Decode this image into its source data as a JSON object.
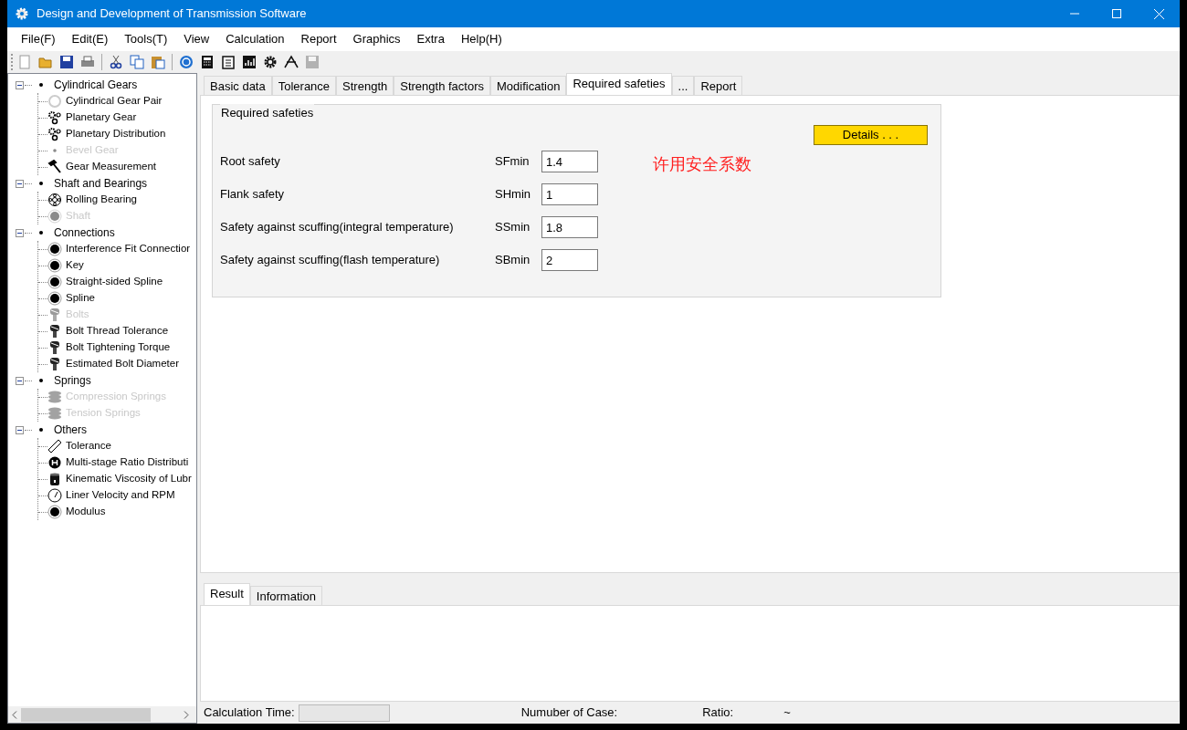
{
  "window": {
    "title": "Design and Development of Transmission Software"
  },
  "menu": [
    "File(F)",
    "Edit(E)",
    "Tools(T)",
    "View",
    "Calculation",
    "Report",
    "Graphics",
    "Extra",
    "Help(H)"
  ],
  "toolbar": [
    {
      "kind": "new",
      "disabled": false
    },
    {
      "kind": "open",
      "disabled": false
    },
    {
      "kind": "save",
      "disabled": false
    },
    {
      "kind": "print",
      "disabled": false
    },
    {
      "kind": "separator"
    },
    {
      "kind": "cut",
      "disabled": false
    },
    {
      "kind": "copy",
      "disabled": false
    },
    {
      "kind": "paste",
      "disabled": false
    },
    {
      "kind": "separator"
    },
    {
      "kind": "help",
      "disabled": false
    },
    {
      "kind": "calculator",
      "disabled": false
    },
    {
      "kind": "clipboard",
      "disabled": false
    },
    {
      "kind": "chart",
      "disabled": false
    },
    {
      "kind": "gear",
      "disabled": false
    },
    {
      "kind": "compass",
      "disabled": false
    },
    {
      "kind": "save",
      "disabled": true
    }
  ],
  "tree": [
    {
      "label": "Cylindrical Gears",
      "expanded": true,
      "children": [
        {
          "label": "Cylindrical Gear Pair",
          "kind": "ring",
          "disabled": false
        },
        {
          "label": "Planetary Gear",
          "kind": "gears",
          "disabled": false
        },
        {
          "label": "Planetary Distribution",
          "kind": "gears",
          "disabled": false
        },
        {
          "label": "Bevel Gear",
          "kind": "dot",
          "disabled": true
        },
        {
          "label": "Gear Measurement",
          "kind": "hammer",
          "disabled": false
        }
      ]
    },
    {
      "label": "Shaft and Bearings",
      "expanded": true,
      "children": [
        {
          "label": "Rolling Bearing",
          "kind": "bearing",
          "disabled": false
        },
        {
          "label": "Shaft",
          "kind": "target",
          "disabled": true
        }
      ]
    },
    {
      "label": "Connections",
      "expanded": true,
      "children": [
        {
          "label": "Interference Fit Connectior",
          "kind": "target",
          "disabled": false
        },
        {
          "label": "Key",
          "kind": "target",
          "disabled": false
        },
        {
          "label": "Straight-sided Spline",
          "kind": "target",
          "disabled": false
        },
        {
          "label": "Spline",
          "kind": "target",
          "disabled": false
        },
        {
          "label": "Bolts",
          "kind": "bolt",
          "disabled": true
        },
        {
          "label": "Bolt Thread Tolerance",
          "kind": "bolt",
          "disabled": false
        },
        {
          "label": "Bolt Tightening Torque",
          "kind": "bolt",
          "disabled": false
        },
        {
          "label": "Estimated Bolt Diameter",
          "kind": "bolt",
          "disabled": false
        }
      ]
    },
    {
      "label": "Springs",
      "expanded": true,
      "children": [
        {
          "label": "Compression Springs",
          "kind": "spring",
          "disabled": true
        },
        {
          "label": "Tension Springs",
          "kind": "spring",
          "disabled": true
        }
      ]
    },
    {
      "label": "Others",
      "expanded": true,
      "children": [
        {
          "label": "Tolerance",
          "kind": "ruler",
          "disabled": false
        },
        {
          "label": "Multi-stage Ratio Distributi",
          "kind": "ratio",
          "disabled": false
        },
        {
          "label": "Kinematic Viscosity of Lubr",
          "kind": "cup",
          "disabled": false
        },
        {
          "label": "Liner Velocity and RPM",
          "kind": "gauge",
          "disabled": false
        },
        {
          "label": "Modulus",
          "kind": "target",
          "disabled": false
        }
      ]
    }
  ],
  "tabs": [
    {
      "label": "Basic data",
      "selected": false
    },
    {
      "label": "Tolerance",
      "selected": false
    },
    {
      "label": "Strength",
      "selected": false
    },
    {
      "label": "Strength factors",
      "selected": false
    },
    {
      "label": "Modification",
      "selected": false
    },
    {
      "label": "Required safeties",
      "selected": true
    },
    {
      "label": "...",
      "selected": false
    },
    {
      "label": "Report",
      "selected": false
    }
  ],
  "group": {
    "title": "Required safeties",
    "details_button": "Details . . .",
    "annotation": "许用安全系数",
    "fields": [
      {
        "label": "Root safety",
        "symbol": "SFmin",
        "value": "1.4"
      },
      {
        "label": "Flank safety",
        "symbol": "SHmin",
        "value": "1"
      },
      {
        "label": "Safety against scuffing(integral temperature)",
        "symbol": "SSmin",
        "value": "1.8"
      },
      {
        "label": "Safety against scuffing(flash temperature)",
        "symbol": "SBmin",
        "value": "2"
      }
    ]
  },
  "bottom_tabs": [
    {
      "label": "Result",
      "selected": true
    },
    {
      "label": "Information",
      "selected": false
    }
  ],
  "status_bar": {
    "calc_time_label": "Calculation Time:",
    "case_label": "Numuber of Case:",
    "ratio_label": "Ratio:",
    "ratio_value": "~"
  }
}
